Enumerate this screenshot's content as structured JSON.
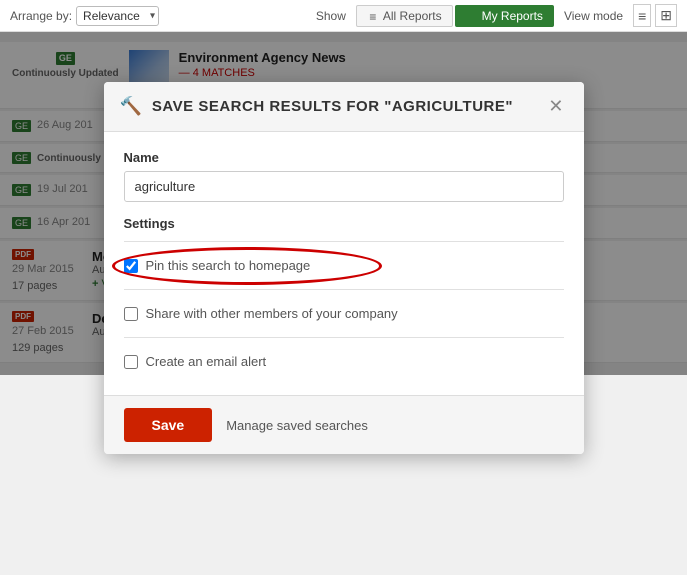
{
  "topbar": {
    "arrange_label": "Arrange by:",
    "arrange_value": "Relevance",
    "show_label": "Show",
    "all_reports_label": "All Reports",
    "my_reports_label": "My Reports",
    "view_mode_label": "View mode",
    "view_list_icon": "≡",
    "view_grid_icon": "⊞"
  },
  "list": {
    "items": [
      {
        "type": "continuous",
        "badge": "GE",
        "date_label": "Continuously Updated",
        "title": "Environment Agency News",
        "matches": "4 MATCHES",
        "has_thumb": true
      },
      {
        "type": "dated",
        "badge": "GE",
        "date_label": "26 Aug 201",
        "title": "",
        "matches": "",
        "has_thumb": false
      },
      {
        "type": "continuous",
        "badge": "GE",
        "date_label": "Continuously Updated",
        "title": "",
        "matches": "",
        "has_thumb": false
      },
      {
        "type": "dated",
        "badge": "GE",
        "date_label": "19 Jul 201",
        "title": "",
        "matches": "",
        "has_thumb": false
      },
      {
        "type": "dated",
        "badge": "GE",
        "date_label": "16 Apr 201",
        "title": "",
        "matches": "",
        "has_thumb": false
      },
      {
        "type": "pdf",
        "badge": "PDF",
        "date_label": "29 Mar 2015",
        "title": "Module document: Emerging Powers and International Development",
        "author": "Authors: Xu Xiuli and Gu Jing",
        "pages": "17 pages",
        "matches_link": "VIEW MATCHES",
        "has_thumb": false
      },
      {
        "type": "pdf",
        "badge": "PDF",
        "date_label": "27 Feb 2015",
        "title": "Development Banks from the BRICS",
        "author": "Authors: Barbara Barone and Stephen Spratt",
        "pages": "129 pages",
        "has_thumb": false
      }
    ]
  },
  "modal": {
    "header_icon": "🔨",
    "title": "SAVE SEARCH RESULTS FOR \"AGRICULTURE\"",
    "close_icon": "✕",
    "name_label": "Name",
    "name_value": "agriculture",
    "name_placeholder": "agriculture",
    "settings_label": "Settings",
    "checkbox1_label": "Pin this search to homepage",
    "checkbox1_checked": true,
    "checkbox2_label": "Share with other members of your company",
    "checkbox2_checked": false,
    "checkbox3_label": "Create an email alert",
    "checkbox3_checked": false,
    "save_label": "Save",
    "manage_label": "Manage saved searches"
  }
}
